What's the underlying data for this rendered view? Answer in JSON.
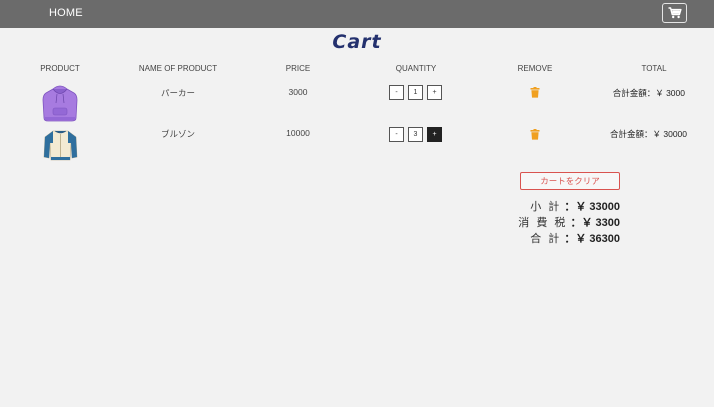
{
  "nav": {
    "home_label": "HOME",
    "cart_icon": "cart-icon"
  },
  "page": {
    "title": "Cart"
  },
  "table": {
    "headers": [
      "PRODUCT",
      "NAME OF PRODUCT",
      "PRICE",
      "QUANTITY",
      "REMOVE",
      "TOTAL"
    ],
    "rows": [
      {
        "image": "hoodie-image",
        "name": "パーカー",
        "price": "3000",
        "minus": "-",
        "quantity": "1",
        "plus": "+",
        "remove_icon": "trash-icon",
        "total": "合計金額：￥ 3000"
      },
      {
        "image": "jacket-image",
        "name": "ブルゾン",
        "price": "10000",
        "minus": "-",
        "quantity": "3",
        "plus": "+",
        "remove_icon": "trash-icon",
        "total": "合計金額：￥ 30000"
      }
    ]
  },
  "actions": {
    "clear_cart": "カートをクリア"
  },
  "summary": {
    "subtotal_label": "小 計",
    "subtotal_value": "：￥ 33000",
    "tax_label": "消 費 税",
    "tax_value": "：￥ 3300",
    "total_label": "合 計",
    "total_value": "：￥ 36300"
  },
  "colors": {
    "navbar": "#6b6b6b",
    "title": "#24316e",
    "trash": "#f0a020",
    "clear_button": "#d9534f"
  }
}
